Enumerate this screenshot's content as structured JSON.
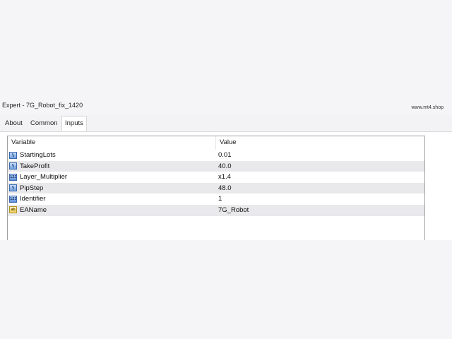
{
  "window": {
    "title": "Expert - 7G_Robot_fix_1420",
    "watermark": "www.mt4.shop"
  },
  "tabs": [
    {
      "label": "About",
      "active": false
    },
    {
      "label": "Common",
      "active": false
    },
    {
      "label": "Inputs",
      "active": true
    }
  ],
  "grid": {
    "columns": {
      "variable": "Variable",
      "value": "Value"
    },
    "rows": [
      {
        "icon": "double-type-icon",
        "icon_text": "½",
        "name": "StartingLots",
        "value": "0.01"
      },
      {
        "icon": "double-type-icon",
        "icon_text": "½",
        "name": "TakeProfit",
        "value": "40.0"
      },
      {
        "icon": "int-type-icon",
        "icon_text": "123",
        "name": "Layer_Multiplier",
        "value": "x1.4"
      },
      {
        "icon": "double-type-icon",
        "icon_text": "½",
        "name": "PipStep",
        "value": "48.0"
      },
      {
        "icon": "int-type-icon",
        "icon_text": "123",
        "name": "Identifier",
        "value": "1"
      },
      {
        "icon": "string-type-icon",
        "icon_text": "ab",
        "name": "EAName",
        "value": "7G_Robot"
      }
    ]
  },
  "colors": {
    "row_alt": "#e9e9ec",
    "border": "#a0a0a0"
  }
}
